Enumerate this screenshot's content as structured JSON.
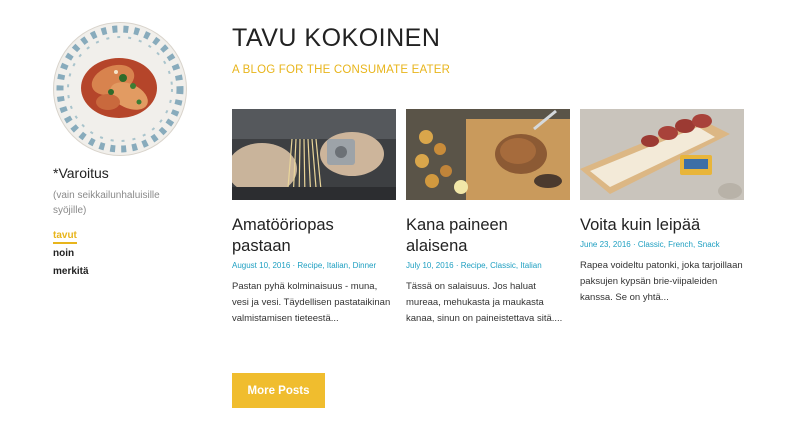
{
  "site": {
    "title": "TAVU KOKOINEN",
    "tagline": "A BLOG FOR THE CONSUMATE EATER"
  },
  "sidebar": {
    "warning_title": "*Varoitus",
    "warning_subtitle": "(vain seikkailunhaluisille syöjille)",
    "nav": [
      {
        "label": "tavut",
        "active": true
      },
      {
        "label": "noin",
        "active": false
      },
      {
        "label": "merkitä",
        "active": false
      }
    ]
  },
  "posts": [
    {
      "title": "Amatööriopas pastaan",
      "date": "August 10, 2016",
      "categories": [
        "Recipe",
        "Italian",
        "Dinner"
      ],
      "excerpt": "Pastan pyhä kolminaisuus - muna, vesi ja vesi. Täydellisen pastataikinan valmistamisen tieteestä...",
      "image": "pasta-making-photo"
    },
    {
      "title": "Kana paineen alaisena",
      "date": "July 10, 2016",
      "categories": [
        "Recipe",
        "Classic",
        "Italian"
      ],
      "excerpt": "Tässä on salaisuus. Jos haluat mureaa, mehukasta ja maukasta kanaa, sinun on paineistettava sitä....",
      "image": "chicken-carving-photo"
    },
    {
      "title": "Voita kuin leipää",
      "date": "June 23, 2016",
      "categories": [
        "Classic",
        "French",
        "Snack"
      ],
      "excerpt": "Rapea voideltu patonki, joka tarjoillaan paksujen kypsän brie-viipaleiden kanssa. Se on yhtä...",
      "image": "baguette-salami-photo"
    }
  ],
  "more_posts_label": "More Posts",
  "colors": {
    "accent": "#e8b51c",
    "button": "#f0bd2e",
    "meta_link": "#1e9fc1"
  }
}
